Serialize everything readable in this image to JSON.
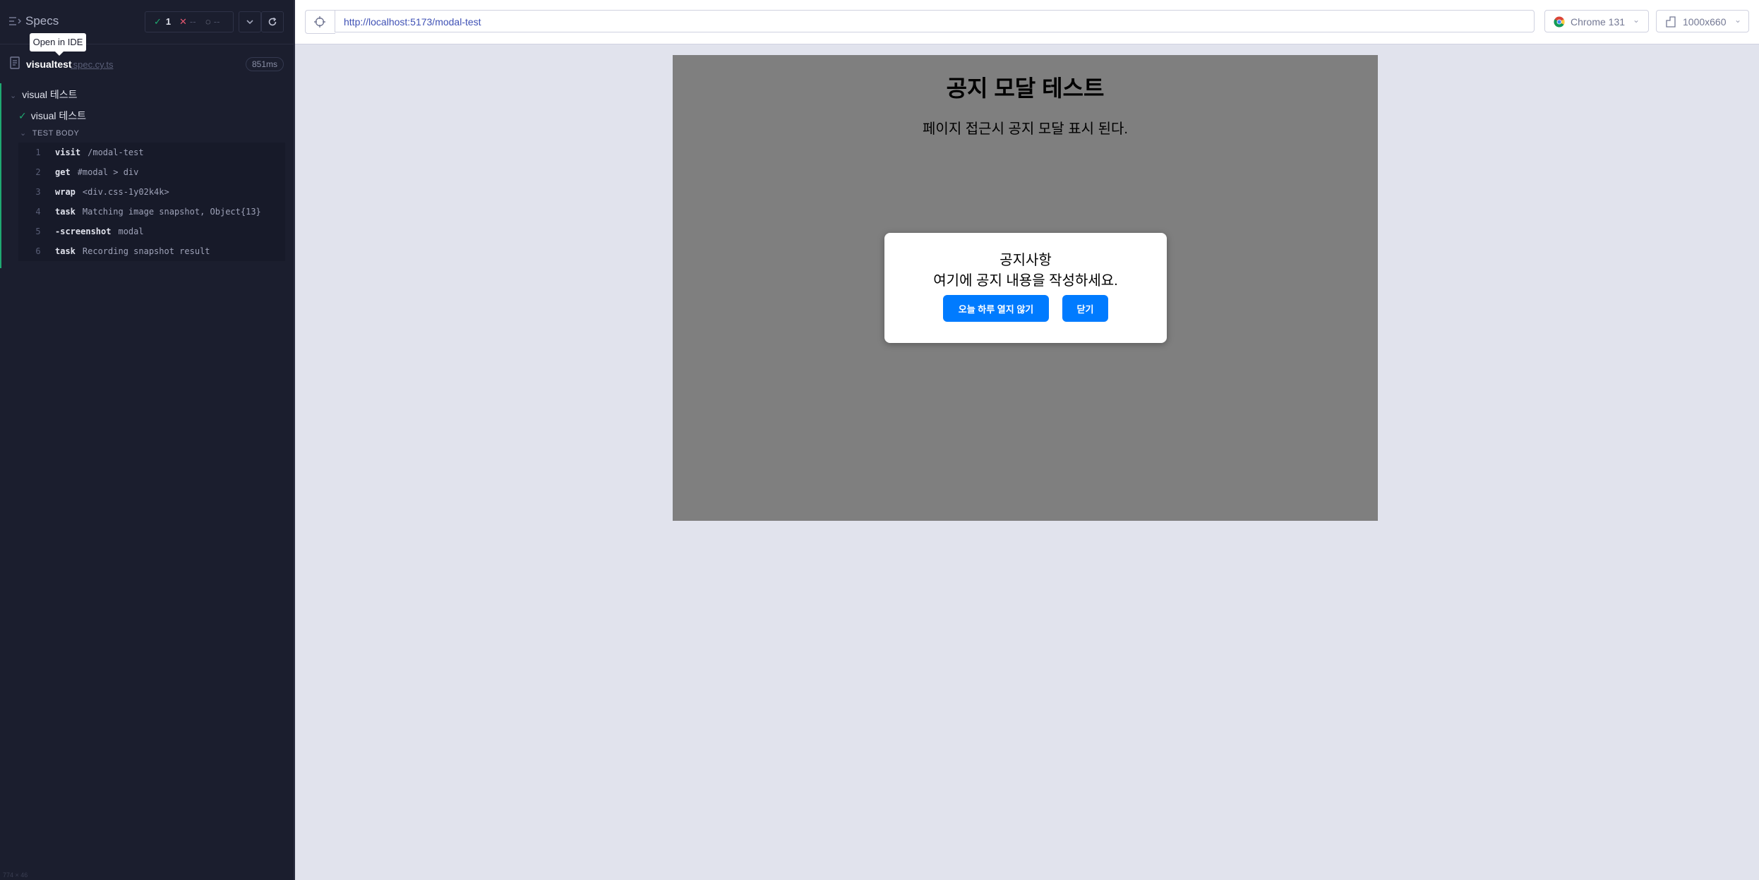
{
  "sidebar": {
    "title": "Specs",
    "stats": {
      "passed": "1",
      "failed": "--",
      "pending": "--"
    },
    "tooltip": "Open in IDE",
    "file": {
      "name": "visualtest",
      "ext": ".spec.cy.ts",
      "duration": "851ms"
    },
    "suite": {
      "name": "visual 테스트",
      "test": "visual 테스트",
      "body_label": "TEST BODY",
      "commands": [
        {
          "num": "1",
          "name": "visit",
          "message": "/modal-test"
        },
        {
          "num": "2",
          "name": "get",
          "message": "#modal > div"
        },
        {
          "num": "3",
          "name": "wrap",
          "message": "<div.css-1y02k4k>"
        },
        {
          "num": "4",
          "name": "task",
          "message": "Matching image snapshot, Object{13}"
        },
        {
          "num": "5",
          "name": "-screenshot",
          "message": "modal"
        },
        {
          "num": "6",
          "name": "task",
          "message": "Recording snapshot result"
        }
      ]
    },
    "footer": "774 × 46"
  },
  "topbar": {
    "url": "http://localhost:5173/modal-test",
    "browser": "Chrome 131",
    "viewport": "1000x660"
  },
  "aut": {
    "title": "공지 모달 테스트",
    "description": "페이지 접근시 공지 모달 표시 된다.",
    "modal": {
      "title": "공지사항",
      "body": "여기에 공지 내용을 작성하세요.",
      "hide_today_label": "오늘 하루 열지 않기",
      "close_label": "닫기"
    }
  },
  "colors": {
    "sidebar_bg": "#1b1e2e",
    "pass": "#1fa971",
    "fail": "#e45770",
    "modal_button": "#007bff",
    "overlay": "rgba(0,0,0,0.5)"
  }
}
